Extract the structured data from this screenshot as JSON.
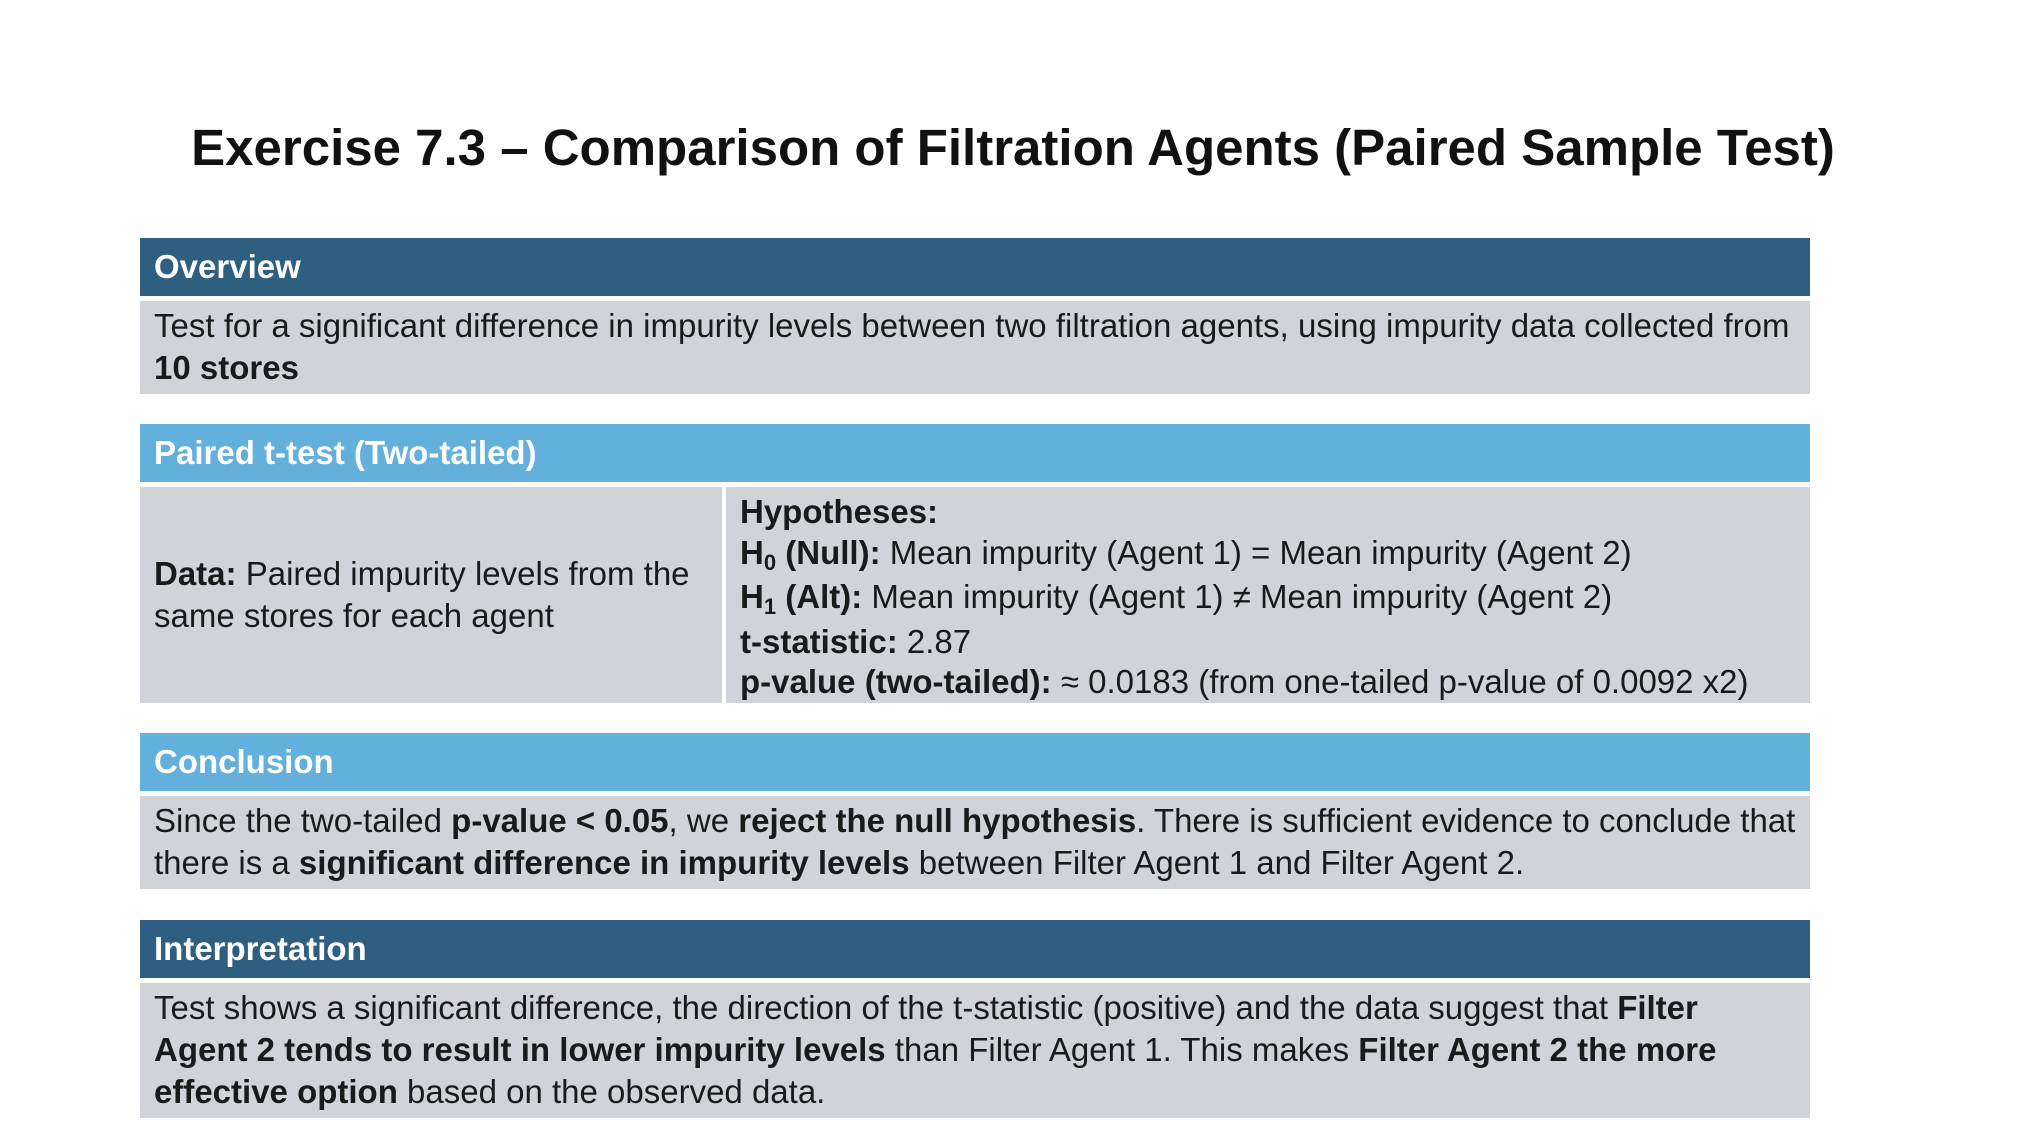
{
  "title": "Exercise 7.3 – Comparison of Filtration Agents (Paired Sample Test)",
  "overview": {
    "header": "Overview",
    "text_1": "Test for a significant difference in impurity levels between two filtration agents, using impurity data collected from ",
    "text_bold": "10 stores"
  },
  "test": {
    "header": "Paired t-test (Two-tailed)",
    "data_label": "Data:",
    "data_text": " Paired impurity levels from the same stores for each agent",
    "hypotheses_label": "Hypotheses:",
    "h0_label": "H",
    "h0_sub": "0",
    "h0_suffix": " (Null):",
    "h0_text": " Mean impurity (Agent 1) = Mean impurity (Agent 2)",
    "h1_label": "H",
    "h1_sub": "1",
    "h1_suffix": " (Alt):",
    "h1_text": " Mean impurity (Agent 1) ≠ Mean impurity (Agent 2)",
    "t_label": "t-statistic:",
    "t_value": " 2.87",
    "p_label": "p-value (two-tailed):",
    "p_text": " ≈ 0.0183 (from one-tailed p-value of 0.0092 x2)"
  },
  "conclusion": {
    "header": "Conclusion",
    "t1": "Since the two-tailed ",
    "b1": "p-value < 0.05",
    "t2": ", we ",
    "b2": "reject the null hypothesis",
    "t3": ". There is sufficient evidence to conclude that there is a ",
    "b3": "significant difference in impurity levels",
    "t4": " between Filter Agent 1 and Filter Agent 2."
  },
  "interpretation": {
    "header": "Interpretation",
    "t1": "Test shows a significant difference, the direction of the t-statistic (positive) and the data suggest that ",
    "b1": "Filter Agent 2 tends to result in lower impurity levels",
    "t2": " than Filter Agent 1. This makes ",
    "b2": "Filter Agent 2 the more effective option",
    "t3": " based on the observed data."
  }
}
